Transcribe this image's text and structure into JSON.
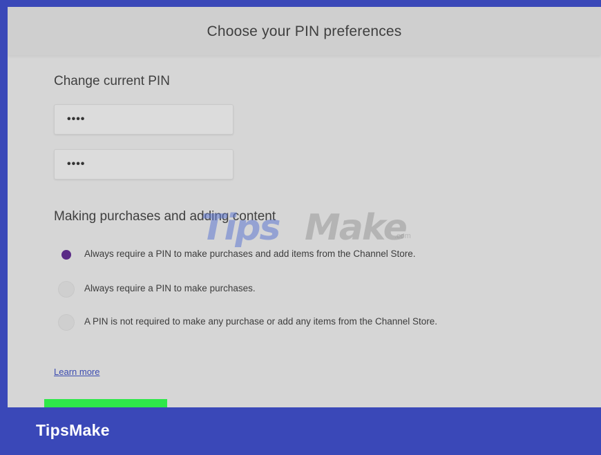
{
  "header": {
    "title": "Choose your PIN preferences"
  },
  "pin_section": {
    "title": "Change current PIN",
    "fields": [
      {
        "value": "••••"
      },
      {
        "value": "••••"
      }
    ]
  },
  "purchase_section": {
    "title": "Making purchases and adding content",
    "options": [
      {
        "label": "Always require a PIN to make purchases and add items from the Channel Store.",
        "selected": true
      },
      {
        "label": "Always require a PIN to make purchases.",
        "selected": false
      },
      {
        "label": "A PIN is not required to make any purchase or add any items from the Channel Store.",
        "selected": false
      }
    ]
  },
  "learn_more": "Learn more",
  "watermark": {
    "tips": "Tips",
    "make": "Make",
    "com": ".com"
  },
  "footer": {
    "brand": "TipsMake"
  },
  "colors": {
    "frame": "#3a48b8",
    "panel": "#d6d6d6",
    "radio_selected": "#5a2a86",
    "button": "#2ee84a",
    "link": "#3b4bb0"
  }
}
